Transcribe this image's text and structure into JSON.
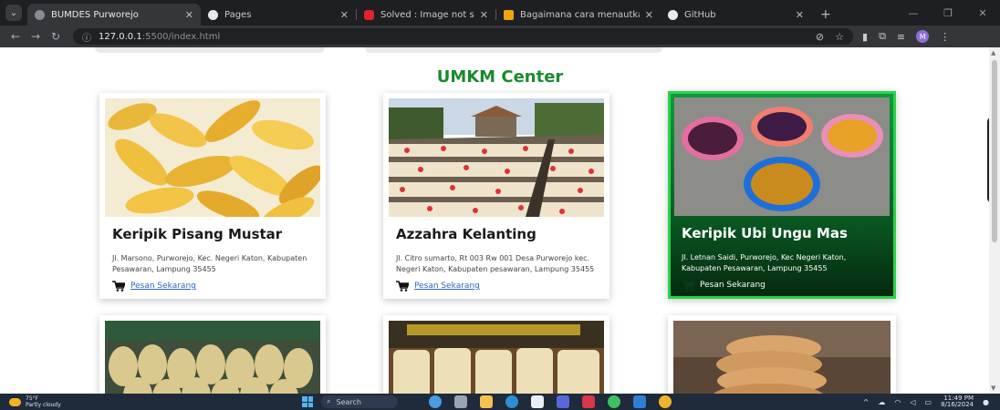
{
  "browser": {
    "tabs": [
      {
        "label": "BUMDES Purworejo",
        "active": true,
        "favicon_color": "#8a8b90"
      },
      {
        "label": "Pages",
        "active": false,
        "favicon_color": "#e8e9ed"
      },
      {
        "label": "Solved : Image not shown on th",
        "active": false,
        "favicon_color": "#e0242a"
      },
      {
        "label": "Bagaimana cara menautkan CS",
        "active": false,
        "favicon_color": "#f0a30a"
      },
      {
        "label": "GitHub",
        "active": false,
        "favicon_color": "#e8e9ed"
      }
    ],
    "url_host": "127.0.0.1",
    "url_path": ":5500/index.html",
    "profile_initial": "M"
  },
  "page": {
    "section_title": "UMKM Center",
    "cards": [
      {
        "name": "Keripik Pisang Mustar",
        "address": "Jl. Marsono, Purworejo, Kec. Negeri Katon, Kabupaten Pesawaran, Lampung 35455",
        "order_label": "Pesan Sekarang",
        "photo": "banana-chips"
      },
      {
        "name": "Azzahra Kelanting",
        "address": "Jl. Citro sumarto, Rt 003 Rw 001 Desa Purworejo kec. Negeri Katon, Kabupaten pesawaran, Lampung 35455",
        "order_label": "Pesan Sekarang",
        "photo": "kelanting-drying"
      },
      {
        "name": "Keripik Ubi Ungu Mas",
        "address": "Jl. Letnan Saidi, Purworejo, Kec Negeri Katon, Kabupaten Pesawaran, Lampung 35455",
        "order_label": "Pesan Sekarang",
        "photo": "ubi-bowls",
        "featured": true
      }
    ],
    "bottom_photos": [
      "packed-snacks",
      "kelanting-bags",
      "rice-crackers"
    ]
  },
  "taskbar": {
    "weather_temp": "75°F",
    "weather_desc": "Partly cloudy",
    "search_label": "Search",
    "time": "11:49 PM",
    "date": "8/16/2024"
  },
  "colors": {
    "title_green": "#1b8a2e",
    "link_blue": "#2f64c8",
    "featured_border": "#27d44a"
  }
}
